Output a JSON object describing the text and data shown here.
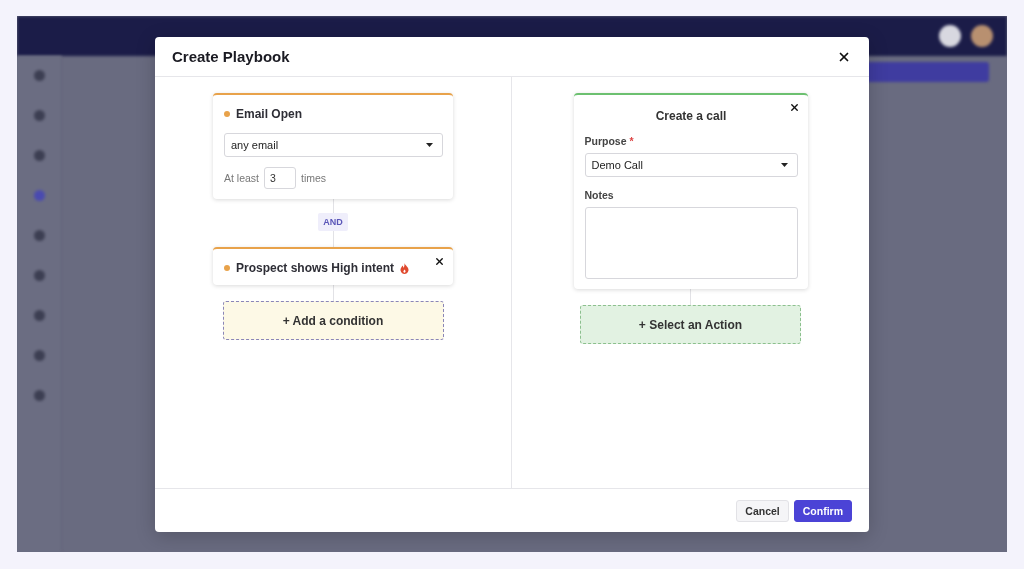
{
  "dialog": {
    "title": "Create Playbook",
    "conditions": [
      {
        "kind": "email",
        "title": "Email Open",
        "select": "any email",
        "prefix": "At least",
        "count": "3",
        "suffix": "times",
        "closable": false
      },
      {
        "kind": "intent",
        "title": "Prospect shows High intent",
        "closable": true
      }
    ],
    "joiner": "AND",
    "add_condition": "+ Add a condition",
    "action": {
      "title": "Create a call",
      "purpose_label": "Purpose",
      "required_mark": "*",
      "purpose_value": "Demo Call",
      "notes_label": "Notes",
      "closable": true
    },
    "select_action": "+ Select an Action",
    "buttons": [
      {
        "label": "Cancel",
        "kind": "secondary"
      },
      {
        "label": "Confirm",
        "kind": "primary"
      }
    ]
  }
}
